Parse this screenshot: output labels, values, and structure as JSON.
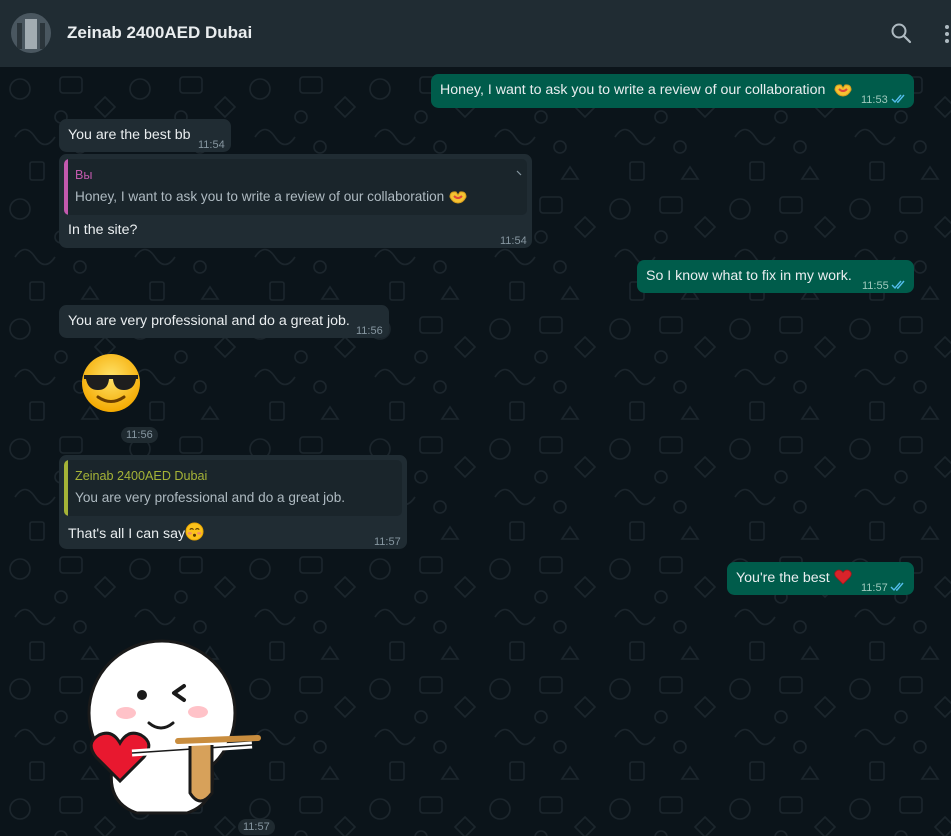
{
  "header": {
    "title": "Zeinab 2400AED Dubai",
    "icons": [
      "search-icon",
      "menu-icon"
    ]
  },
  "messages": [
    {
      "id": "m1",
      "dir": "out",
      "text": "Honey, I want to ask you to write a review of our collaboration",
      "time": "11:53",
      "emoji": "heart-hands"
    },
    {
      "id": "m2",
      "dir": "in",
      "text": "You are the best bb",
      "time": "11:54"
    },
    {
      "id": "m3",
      "dir": "in",
      "quote": {
        "author": "Вы",
        "text": "Honey, I want to ask you to write a review of our collaboration",
        "emoji": "heart-hands"
      },
      "text": "In the site?",
      "time": "11:54"
    },
    {
      "id": "m4",
      "dir": "out",
      "text": "So I know what to fix in my work.",
      "time": "11:55"
    },
    {
      "id": "m5",
      "dir": "in",
      "text": "You are very professional and do a great job.",
      "time": "11:56"
    },
    {
      "id": "m6",
      "dir": "in",
      "sticker": "sunglasses-emoji",
      "time": "11:56"
    },
    {
      "id": "m7",
      "dir": "in",
      "quote": {
        "author": "Zeinab 2400AED Dubai",
        "text": "You are very professional and do a great job."
      },
      "text": "That's all I can say",
      "emoji": "blushing-face",
      "time": "11:57"
    },
    {
      "id": "m8",
      "dir": "out",
      "text": "You're the best",
      "emoji": "red-heart",
      "time": "11:57"
    },
    {
      "id": "m9",
      "dir": "in",
      "sticker": "heart-slingshot-sticker",
      "time": "11:57"
    }
  ],
  "colors": {
    "header_bg": "#202c33",
    "chat_bg": "#0b141a",
    "incoming": "#202c33",
    "outgoing": "#005c4b",
    "quote_self": "#c359ae",
    "quote_other": "#a5b337",
    "read_ticks": "#53bdeb"
  }
}
